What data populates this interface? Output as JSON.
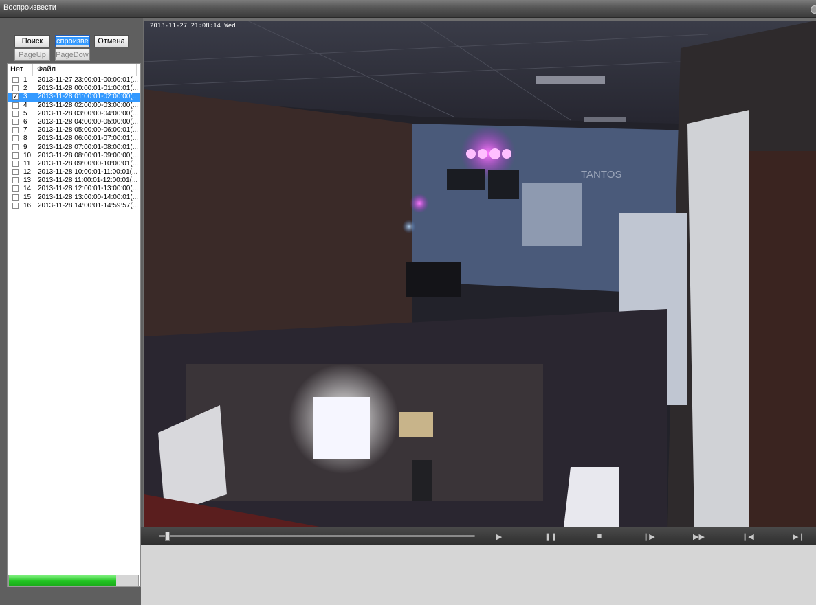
{
  "window": {
    "title": "Воспроизвести"
  },
  "toolbar": {
    "search_label": "Поиск",
    "play_label": "спроизвес",
    "cancel_label": "Отмена",
    "pageup_label": "PageUp",
    "pagedown_label": "PageDown"
  },
  "file_list": {
    "columns": [
      "Нет",
      "Файл"
    ],
    "rows": [
      {
        "num": "1",
        "file": "2013-11-27 23:00:01-00:00:01(...",
        "checked": false,
        "selected": false
      },
      {
        "num": "2",
        "file": "2013-11-28 00:00:01-01:00:01(...",
        "checked": false,
        "selected": false
      },
      {
        "num": "3",
        "file": "2013-11-28 01:00:01-02:00:00(...",
        "checked": true,
        "selected": true
      },
      {
        "num": "4",
        "file": "2013-11-28 02:00:00-03:00:00(...",
        "checked": false,
        "selected": false
      },
      {
        "num": "5",
        "file": "2013-11-28 03:00:00-04:00:00(...",
        "checked": false,
        "selected": false
      },
      {
        "num": "6",
        "file": "2013-11-28 04:00:00-05:00:00(...",
        "checked": false,
        "selected": false
      },
      {
        "num": "7",
        "file": "2013-11-28 05:00:00-06:00:01(...",
        "checked": false,
        "selected": false
      },
      {
        "num": "8",
        "file": "2013-11-28 06:00:01-07:00:01(...",
        "checked": false,
        "selected": false
      },
      {
        "num": "9",
        "file": "2013-11-28 07:00:01-08:00:01(...",
        "checked": false,
        "selected": false
      },
      {
        "num": "10",
        "file": "2013-11-28 08:00:01-09:00:00(...",
        "checked": false,
        "selected": false
      },
      {
        "num": "11",
        "file": "2013-11-28 09:00:00-10:00:01(...",
        "checked": false,
        "selected": false
      },
      {
        "num": "12",
        "file": "2013-11-28 10:00:01-11:00:01(...",
        "checked": false,
        "selected": false
      },
      {
        "num": "13",
        "file": "2013-11-28 11:00:01-12:00:01(...",
        "checked": false,
        "selected": false
      },
      {
        "num": "14",
        "file": "2013-11-28 12:00:01-13:00:00(...",
        "checked": false,
        "selected": false
      },
      {
        "num": "15",
        "file": "2013-11-28 13:00:00-14:00:01(...",
        "checked": false,
        "selected": false
      },
      {
        "num": "16",
        "file": "2013-11-28 14:00:01-14:59:57(...",
        "checked": false,
        "selected": false
      }
    ]
  },
  "progress": {
    "fraction": 0.83,
    "color": "#21c321"
  },
  "video": {
    "osd_text": "2013-11-27 21:08:14 Wed",
    "wall_sign": "TANTOS"
  },
  "playback": {
    "position_fraction": 0.02,
    "controls": [
      {
        "name": "play-icon",
        "glyph": "▶"
      },
      {
        "name": "pause-icon",
        "glyph": "❚❚"
      },
      {
        "name": "stop-icon",
        "glyph": "■"
      },
      {
        "name": "step-forward-icon",
        "glyph": "❙▶"
      },
      {
        "name": "fast-forward-icon",
        "glyph": "▶▶"
      },
      {
        "name": "skip-start-icon",
        "glyph": "❙◀"
      },
      {
        "name": "skip-end-icon",
        "glyph": "▶❙"
      }
    ]
  },
  "colors": {
    "selection": "#3399ff",
    "window_bg": "#6e6e6e"
  }
}
